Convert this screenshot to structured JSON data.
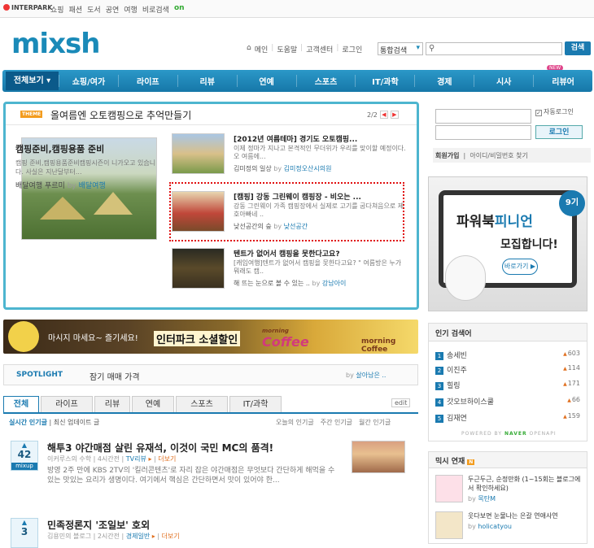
{
  "topbar": {
    "logo": "INTERPARK",
    "links": [
      "쇼핑",
      "패션",
      "도서",
      "공연",
      "여행",
      "비로검색"
    ],
    "on_label": "on"
  },
  "brand": "mixsh",
  "utils": [
    "메인",
    "도움말",
    "고객센터",
    "로그인"
  ],
  "search": {
    "select": "통합검색",
    "button": "검색"
  },
  "nav": {
    "all": "전체보기 ▾",
    "items": [
      "쇼핑/여가",
      "라이프",
      "리뷰",
      "연예",
      "스포츠",
      "IT/과학",
      "경제",
      "시사",
      "리뷰어"
    ],
    "new_badge": "NEW"
  },
  "theme": {
    "tag": "THEME",
    "title": "올여름엔 오토캠핑으로 추억만들기",
    "pager": "2/2",
    "main": {
      "title": "캠핑준비,캠핑용품 준비",
      "desc": "캠핑 준비,캠핑용품준비캠핑시즌이 니가오고 있습니다. 사실은 지난달부터...",
      "author": "배달여행 푸르미",
      "by": "by",
      "blog": "배달여행"
    },
    "side": [
      {
        "title": "[2012년 여름테마] 경기도 오토캠핑...",
        "desc": "이제 정마가 지나고 본격적인 무더위가 우리를 맞이할 예정이다.오 여름에...",
        "author": "김미정의 일상",
        "by": "by",
        "blog": "김미정오산시의원"
      },
      {
        "title": "[캠핑] 강동 그린웨이 캠핑장 - 비오는 ...",
        "desc": "강동 그린웨이 가족 캠핑장에서 실제로 고기를 굽다쳐음으로 제호아빠네 ..",
        "author": "낮선공간의 숲",
        "by": "by",
        "blog": "낮선공간"
      },
      {
        "title": "텐트가 없어서 캠핑을 못한다고요?",
        "desc": "[캐임여행]텐트가 없어서 캠핑을 못한다고요? \" 여름방은 누가 뭐래도 캠..",
        "author": "해 뜨는 눈으로 볼 수 있는 ..",
        "by": "by",
        "blog": "강남아이"
      }
    ]
  },
  "banner": {
    "t1": "마시지 마세요~ 즐기세요!",
    "t2": "인터파크 소셜할인",
    "t3": "Coffee",
    "t3_small": "morning",
    "t4": "morning Coffee"
  },
  "spotlight": {
    "label": "SPOTLIGHT",
    "text": "잠기 매매 가격",
    "by": "by",
    "author": "살아남은 .."
  },
  "tabs": [
    "전체",
    "라이프",
    "리뷰",
    "연예",
    "스포츠",
    "IT/과학"
  ],
  "edit": "edit",
  "subtabs": {
    "active": "실시간 인기글",
    "other": "최신 업데이트 글"
  },
  "rsub": [
    "오늘의 인기글",
    "주간 인기글",
    "월간 인기글"
  ],
  "posts": [
    {
      "votes": "42",
      "mx": "mixup",
      "title": "해투3 야간매점 살린 유재석, 이것이 국민 MC의 품격!",
      "author": "이커루스의 수학",
      "time": "4시간전",
      "cat": "TV리뷰",
      "more": "더보기",
      "desc": "방영 2주 만에 KBS 2TV의 '킬러콘텐츠'로 자리 잡은 야간매점은 무엇보다 간단하게 해먹을 수 있는 맛있는 요리가 생명이다. 여기에서 핵심은 간단하면서 맛이 있어야 한..."
    },
    {
      "votes": "3",
      "mx": "mixup",
      "title": "민족정론지 '조일보' 호외",
      "author": "김용민의 블로그",
      "time": "2시간전",
      "cat": "경제일반",
      "more": "더보기",
      "desc": ""
    }
  ],
  "login": {
    "auto": "자동로그인",
    "button": "로그인",
    "join": "회원가입",
    "find": "아이디/비밀번호 찾기"
  },
  "promo": {
    "line1a": "파워북",
    "line1b": "피니언",
    "line2": "모집합니다!",
    "badge": "9기",
    "go": "바로가기 ▶"
  },
  "hot": {
    "title": "인기 검색어",
    "items": [
      {
        "n": "1",
        "w": "송세빈",
        "v": "603"
      },
      {
        "n": "2",
        "w": "이진주",
        "v": "114"
      },
      {
        "n": "3",
        "w": "힐링",
        "v": "171"
      },
      {
        "n": "4",
        "w": "갓오브하이스쿨",
        "v": "66"
      },
      {
        "n": "5",
        "w": "김재연",
        "v": "159"
      }
    ],
    "powered": "POWERED BY",
    "naver": "NAVER",
    "openapi": "OPENAPI"
  },
  "mix": {
    "title": "믹시 연재",
    "new": "N",
    "items": [
      {
        "title": "두근두근, 순정만화 (1~15회는 블로그에서 확인하세요)",
        "by": "by",
        "author": "목탄M"
      },
      {
        "title": "웃다보면 눈물나는 은갈 연애사연",
        "by": "by",
        "author": "holicatyou"
      }
    ]
  }
}
